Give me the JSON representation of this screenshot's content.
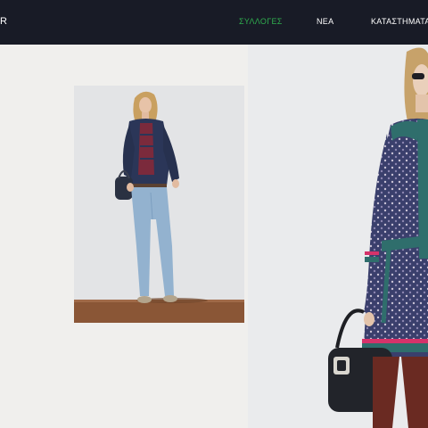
{
  "header": {
    "logo_fragment": "R",
    "nav": [
      {
        "label": "ΣΥΛΛΟΓΕΣ",
        "active": true
      },
      {
        "label": "ΝΕΑ",
        "active": false
      },
      {
        "label": "ΚΑΤΑΣΤΗΜΑΤΑ",
        "active": false
      }
    ]
  },
  "colors": {
    "header_bg": "#181b26",
    "nav_active": "#2fae4e",
    "nav_text": "#ffffff",
    "page_bg": "#f0efed"
  },
  "images": [
    {
      "name": "model-photo-jeans-outfit",
      "icon": "photo"
    },
    {
      "name": "model-photo-patterned-dress",
      "icon": "photo"
    }
  ]
}
